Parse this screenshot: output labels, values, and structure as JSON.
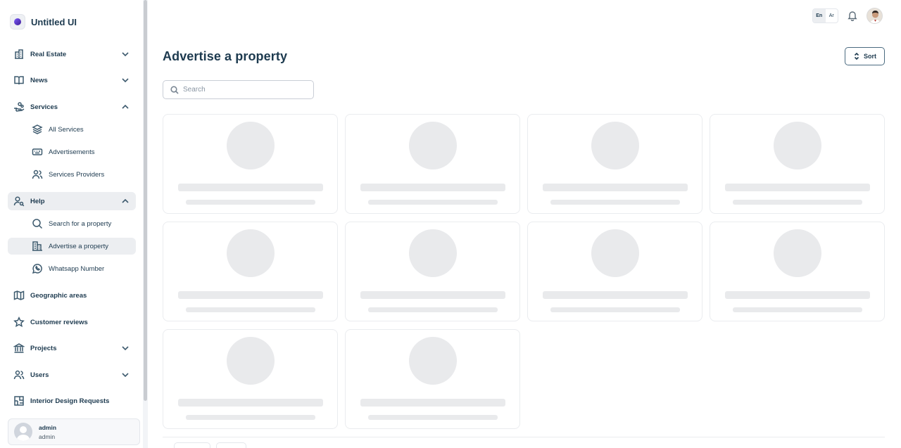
{
  "brand": {
    "name": "Untitled UI"
  },
  "sidebar": {
    "items": [
      {
        "label": "Real Estate",
        "icon": "building-icon",
        "chevron": "down"
      },
      {
        "label": "News",
        "icon": "book-open-icon",
        "chevron": "down"
      },
      {
        "label": "Services",
        "icon": "hand-coins-icon",
        "chevron": "up"
      },
      {
        "label": "Help",
        "icon": "user-search-icon",
        "chevron": "up",
        "active": true
      },
      {
        "label": "Geographic areas",
        "icon": "map-icon"
      },
      {
        "label": "Customer reviews",
        "icon": "star-icon"
      },
      {
        "label": "Projects",
        "icon": "bank-icon",
        "chevron": "down"
      },
      {
        "label": "Users",
        "icon": "users-icon",
        "chevron": "down"
      },
      {
        "label": "Interior Design Requests",
        "icon": "floor-plan-icon"
      }
    ],
    "services_sub": [
      {
        "label": "All Services",
        "icon": "layers-icon"
      },
      {
        "label": "Advertisements",
        "icon": "keyboard-icon"
      },
      {
        "label": "Services Providers",
        "icon": "users-icon"
      }
    ],
    "help_sub": [
      {
        "label": "Search for a property",
        "icon": "search-icon"
      },
      {
        "label": "Advertise a property",
        "icon": "building-icon",
        "active": true
      },
      {
        "label": "Whatsapp Number",
        "icon": "whatsapp-icon"
      }
    ]
  },
  "user": {
    "name": "admin",
    "role": "admin"
  },
  "header": {
    "lang_en": "En",
    "lang_ar": "Ar",
    "selected_lang": "En"
  },
  "main": {
    "title": "Advertise a property",
    "sort_label": "Sort",
    "search_placeholder": "Search",
    "skeleton_card_count": 10
  },
  "colors": {
    "primary_text": "#1d3a4f",
    "skeleton": "#e9eaec",
    "active_bg": "#eceef1"
  }
}
